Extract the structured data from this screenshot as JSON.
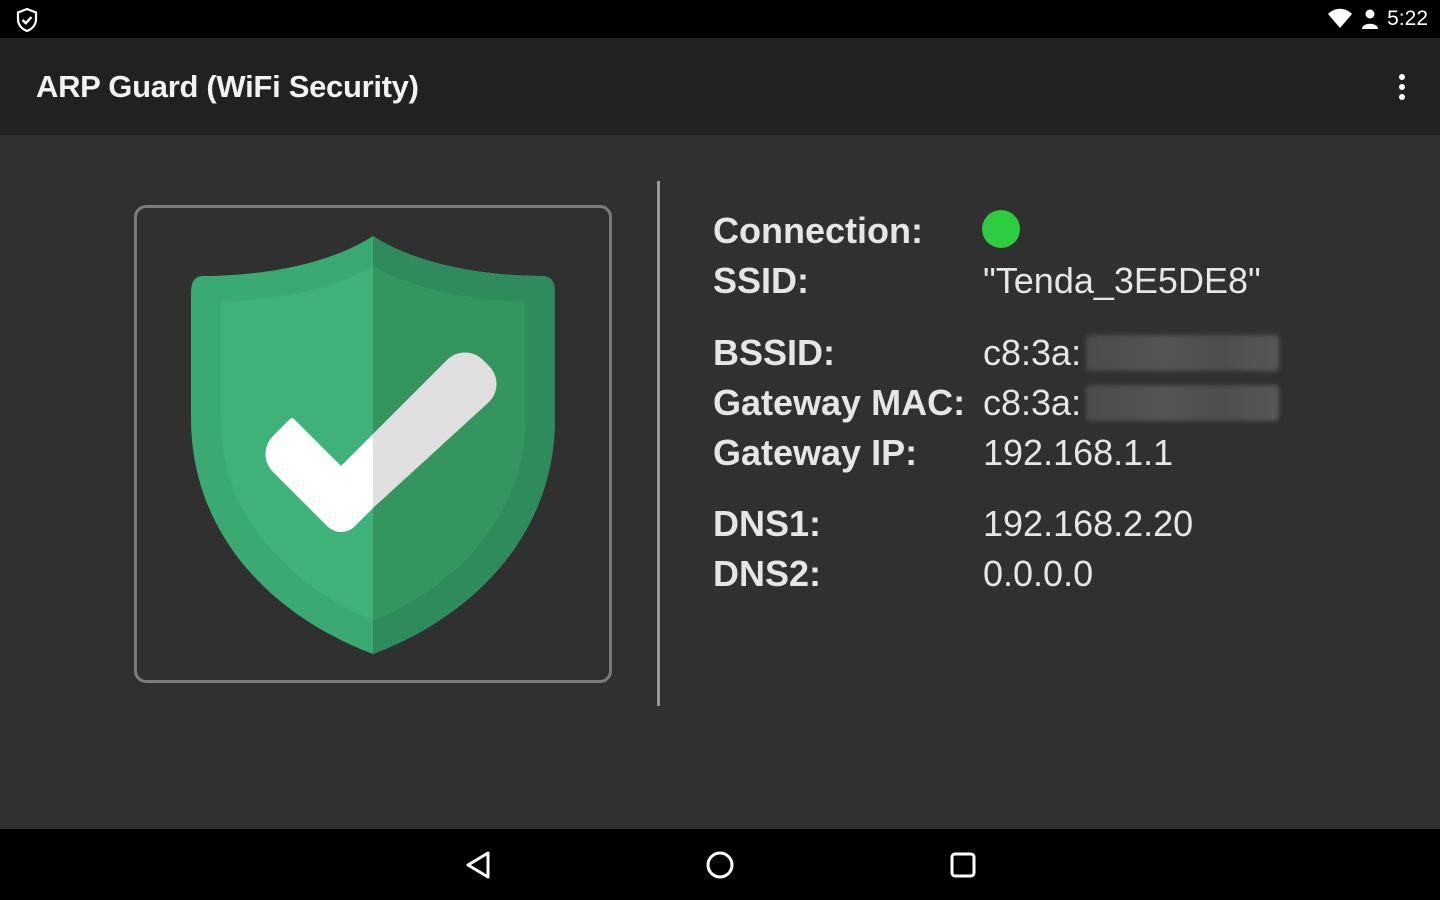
{
  "status_bar": {
    "time": "5:22",
    "left_icon": "shield-check-icon",
    "right_icons": [
      "wifi-icon",
      "account-icon"
    ]
  },
  "app_bar": {
    "title": "ARP Guard (WiFi Security)",
    "menu_icon": "overflow-menu-icon"
  },
  "shield": {
    "icon": "shield-check-icon",
    "status": "secure",
    "colors": {
      "shield_light": "#3aaa72",
      "shield_dark": "#2f8b5b",
      "check": "#ffffff"
    }
  },
  "info": {
    "connection": {
      "label": "Connection:",
      "status_color": "#2ecc40"
    },
    "ssid": {
      "label": "SSID:",
      "value": "\"Tenda_3E5DE8\""
    },
    "bssid": {
      "label": "BSSID:",
      "value": "c8:3a:"
    },
    "gateway_mac": {
      "label": "Gateway MAC:",
      "value": "c8:3a:"
    },
    "gateway_ip": {
      "label": "Gateway IP:",
      "value": "192.168.1.1"
    },
    "dns1": {
      "label": "DNS1:",
      "value": "192.168.2.20"
    },
    "dns2": {
      "label": "DNS2:",
      "value": "0.0.0.0"
    }
  },
  "nav_bar": {
    "icons": [
      "back-icon",
      "home-icon",
      "recents-icon"
    ]
  }
}
